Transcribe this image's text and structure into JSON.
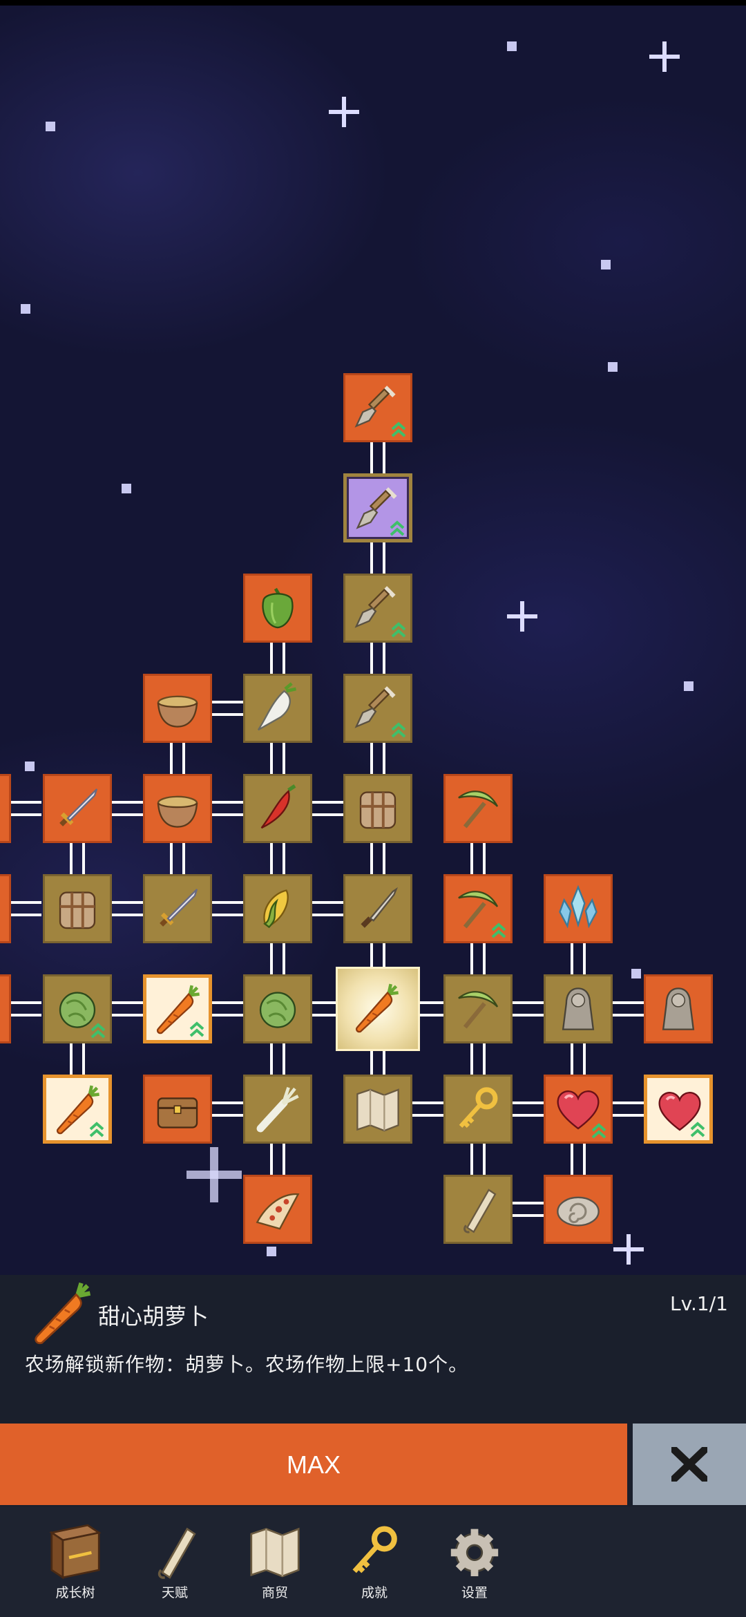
{
  "tree_nodes": [
    {
      "id": "shovel-1",
      "icon": "shovel-icon",
      "style": "orange",
      "upgrade": true
    },
    {
      "id": "shovel-enchanted",
      "icon": "shovel-icon",
      "style": "purple",
      "upgrade": true
    },
    {
      "id": "shovel-2",
      "icon": "shovel-icon",
      "style": "brown",
      "upgrade": true
    },
    {
      "id": "pepper",
      "icon": "green-pepper-icon",
      "style": "orange",
      "upgrade": false
    },
    {
      "id": "bowl-1",
      "icon": "bowl-icon",
      "style": "orange",
      "upgrade": false
    },
    {
      "id": "radish",
      "icon": "radish-icon",
      "style": "brown",
      "upgrade": false
    },
    {
      "id": "shovel-3",
      "icon": "shovel-icon",
      "style": "brown",
      "upgrade": true
    },
    {
      "id": "sword-1",
      "icon": "sword-icon",
      "style": "orange",
      "upgrade": false
    },
    {
      "id": "bowl-2",
      "icon": "bowl-icon",
      "style": "orange",
      "upgrade": false
    },
    {
      "id": "chili",
      "icon": "chili-icon",
      "style": "brown",
      "upgrade": false
    },
    {
      "id": "backpack-1",
      "icon": "backpack-icon",
      "style": "brown",
      "upgrade": false
    },
    {
      "id": "pickaxe-1",
      "icon": "pickaxe-icon",
      "style": "orange",
      "upgrade": false
    },
    {
      "id": "backpack-2",
      "icon": "backpack-icon",
      "style": "brown",
      "upgrade": false
    },
    {
      "id": "sword-2",
      "icon": "sword-icon",
      "style": "brown",
      "upgrade": false
    },
    {
      "id": "corn",
      "icon": "corn-icon",
      "style": "brown",
      "upgrade": false
    },
    {
      "id": "dagger",
      "icon": "dagger-icon",
      "style": "brown",
      "upgrade": false
    },
    {
      "id": "pickaxe-2",
      "icon": "pickaxe-icon",
      "style": "orange",
      "upgrade": true
    },
    {
      "id": "crystal",
      "icon": "crystal-icon",
      "style": "orange",
      "upgrade": false
    },
    {
      "id": "cabbage-1",
      "icon": "cabbage-icon",
      "style": "brown",
      "upgrade": true
    },
    {
      "id": "carrot-1",
      "icon": "carrot-icon",
      "style": "gold",
      "upgrade": true
    },
    {
      "id": "cabbage-2",
      "icon": "cabbage-icon",
      "style": "brown",
      "upgrade": false
    },
    {
      "id": "carrot-selected",
      "icon": "carrot-icon",
      "style": "selected",
      "upgrade": false
    },
    {
      "id": "pickaxe-3",
      "icon": "pickaxe-icon",
      "style": "brown",
      "upgrade": false
    },
    {
      "id": "statue-1",
      "icon": "statue-icon",
      "style": "brown",
      "upgrade": false
    },
    {
      "id": "statue-2",
      "icon": "statue-icon",
      "style": "orange",
      "upgrade": false
    },
    {
      "id": "carrot-2",
      "icon": "carrot-icon",
      "style": "gold",
      "upgrade": true
    },
    {
      "id": "chest",
      "icon": "chest-icon",
      "style": "orange",
      "upgrade": false
    },
    {
      "id": "leek",
      "icon": "leek-icon",
      "style": "brown",
      "upgrade": false
    },
    {
      "id": "map",
      "icon": "map-icon",
      "style": "brown",
      "upgrade": false
    },
    {
      "id": "key",
      "icon": "key-icon",
      "style": "brown",
      "upgrade": false
    },
    {
      "id": "heart-1",
      "icon": "heart-icon",
      "style": "orange",
      "upgrade": true
    },
    {
      "id": "heart-2",
      "icon": "heart-icon",
      "style": "gold",
      "upgrade": true
    },
    {
      "id": "pizza",
      "icon": "pizza-icon",
      "style": "orange",
      "upgrade": false
    },
    {
      "id": "scroll",
      "icon": "scroll-icon",
      "style": "brown",
      "upgrade": false
    },
    {
      "id": "fossil",
      "icon": "fossil-icon",
      "style": "orange",
      "upgrade": false
    }
  ],
  "detail": {
    "icon": "carrot-icon",
    "name": "甜心胡萝卜",
    "level": "Lv.1/1",
    "description": "农场解锁新作物：胡萝卜。农场作物上限+10个。"
  },
  "actions": {
    "max_label": "MAX",
    "close_icon": "close-icon"
  },
  "nav": [
    {
      "id": "growth-tree",
      "label": "成长树",
      "icon": "book-icon"
    },
    {
      "id": "talent",
      "label": "天赋",
      "icon": "scroll-icon"
    },
    {
      "id": "trade",
      "label": "商贸",
      "icon": "map-icon"
    },
    {
      "id": "achievement",
      "label": "成就",
      "icon": "key-icon"
    },
    {
      "id": "settings",
      "label": "设置",
      "icon": "gear-icon"
    }
  ],
  "colors": {
    "orange_tile": "#e0622a",
    "brown_tile": "#a0843f",
    "panel": "#1a1f2c",
    "max_button": "#e0612a",
    "close_button": "#9aa6b4"
  }
}
